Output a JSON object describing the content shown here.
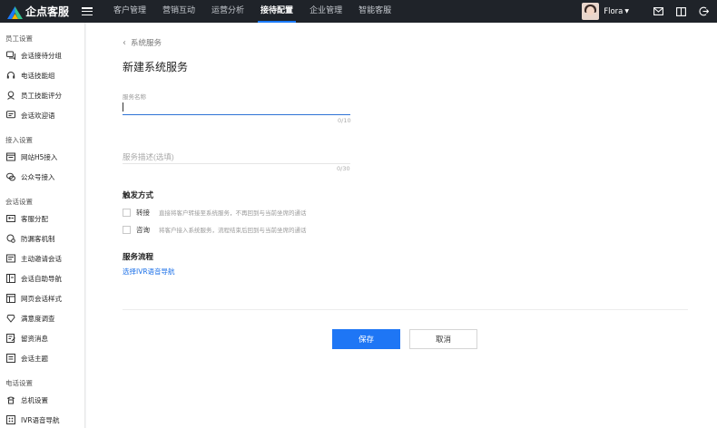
{
  "app": {
    "name": "企点客服"
  },
  "topnav": {
    "items": [
      {
        "label": "客户管理"
      },
      {
        "label": "营销互动"
      },
      {
        "label": "运营分析"
      },
      {
        "label": "接待配置",
        "active": true
      },
      {
        "label": "企业管理"
      },
      {
        "label": "智能客服"
      }
    ],
    "user_name": "Flora",
    "icons": [
      "mail-icon",
      "book-icon",
      "logout-icon"
    ]
  },
  "sidebar": {
    "groups": [
      {
        "title": "员工设置",
        "items": [
          {
            "label": "会话接待分组",
            "icon": "chat-group-icon"
          },
          {
            "label": "电话技能组",
            "icon": "headset-icon"
          },
          {
            "label": "员工技能评分",
            "icon": "badge-icon"
          },
          {
            "label": "会话欢迎语",
            "icon": "welcome-icon"
          }
        ]
      },
      {
        "title": "接入设置",
        "items": [
          {
            "label": "网站H5接入",
            "icon": "web-icon"
          },
          {
            "label": "公众号接入",
            "icon": "wechat-icon"
          }
        ]
      },
      {
        "title": "会话设置",
        "items": [
          {
            "label": "客服分配",
            "icon": "assign-icon"
          },
          {
            "label": "防漏客机制",
            "icon": "shield-icon"
          },
          {
            "label": "主动邀请会话",
            "icon": "invite-icon"
          },
          {
            "label": "会话自助导航",
            "icon": "navigation-icon"
          },
          {
            "label": "网页会话样式",
            "icon": "style-icon"
          },
          {
            "label": "满意度调查",
            "icon": "satisfaction-icon"
          },
          {
            "label": "留资消息",
            "icon": "form-icon"
          },
          {
            "label": "会话主题",
            "icon": "topic-icon"
          }
        ]
      },
      {
        "title": "电话设置",
        "items": [
          {
            "label": "总机设置",
            "icon": "phone-icon"
          },
          {
            "label": "IVR语音导航",
            "icon": "ivr-icon"
          }
        ]
      }
    ]
  },
  "main": {
    "back_label": "系统服务",
    "title": "新建系统服务",
    "name_field": {
      "label": "服务名称",
      "value": "",
      "counter": "0/10"
    },
    "desc_field": {
      "placeholder": "服务描述(选填)",
      "value": "",
      "counter": "0/30"
    },
    "trigger": {
      "title": "触发方式",
      "options": [
        {
          "label": "转接",
          "desc": "直接将客户转接至系统服务，不再回到与当前坐席的通话",
          "checked": false
        },
        {
          "label": "咨询",
          "desc": "将客户接入系统服务，流程结束后回到与当前坐席的通话",
          "checked": false
        }
      ]
    },
    "flow": {
      "title": "服务流程",
      "link": "选择IVR语音导航"
    },
    "buttons": {
      "save": "保存",
      "cancel": "取消"
    }
  },
  "colors": {
    "accent": "#1e76f5",
    "topbar": "#1f2329"
  }
}
